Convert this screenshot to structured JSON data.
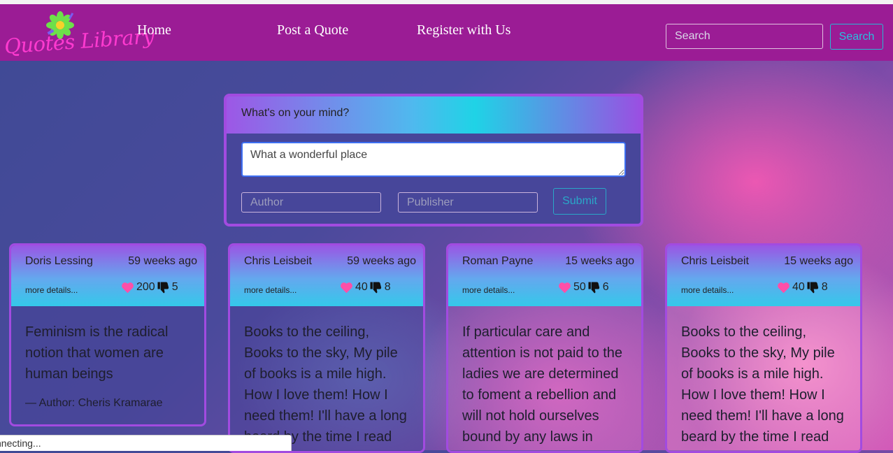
{
  "nav": {
    "logo_text": "Quotes Library",
    "links": [
      "Home",
      "Post a Quote",
      "Register with Us"
    ],
    "search_placeholder": "Search",
    "search_button": "Search"
  },
  "post_form": {
    "header": "What's on your mind?",
    "quote_value": "What a wonderful place",
    "author_placeholder": "Author",
    "publisher_placeholder": "Publisher",
    "submit_label": "Submit"
  },
  "quotes": [
    {
      "author": "Doris Lessing",
      "time": "59 weeks ago",
      "more": "more details...",
      "likes": "200",
      "dislikes": "5",
      "text": "Feminism is the radical notion that women are human beings",
      "attribution": "— Author: Cheris Kramarae"
    },
    {
      "author": "Chris Leisbeit",
      "time": "59 weeks ago",
      "more": "more details...",
      "likes": "40",
      "dislikes": "8",
      "text": "Books to the ceiling, Books to the sky, My pile of books is a mile high. How I love them! How I need them! I'll have a long beard by the time I read"
    },
    {
      "author": "Roman Payne",
      "time": "15 weeks ago",
      "more": "more details...",
      "likes": "50",
      "dislikes": "6",
      "text": "If particular care and attention is not paid to the ladies we are determined to foment a rebellion and will not hold ourselves bound by any laws in"
    },
    {
      "author": "Chris Leisbeit",
      "time": "15 weeks ago",
      "more": "more details...",
      "likes": "40",
      "dislikes": "8",
      "text": "Books to the ceiling, Books to the sky, My pile of books is a mile high. How I love them! How I need them! I'll have a long beard by the time I read"
    }
  ],
  "status": "nnecting...",
  "colors": {
    "navbar": "#9b1c95",
    "logo_text": "#ff3ad0",
    "search_button": "#27c1e0",
    "card_border": "#a24be0",
    "heart": "#ff4fa8"
  },
  "icons": [
    "flower-logo-icon",
    "heart-icon",
    "thumbs-down-icon"
  ]
}
